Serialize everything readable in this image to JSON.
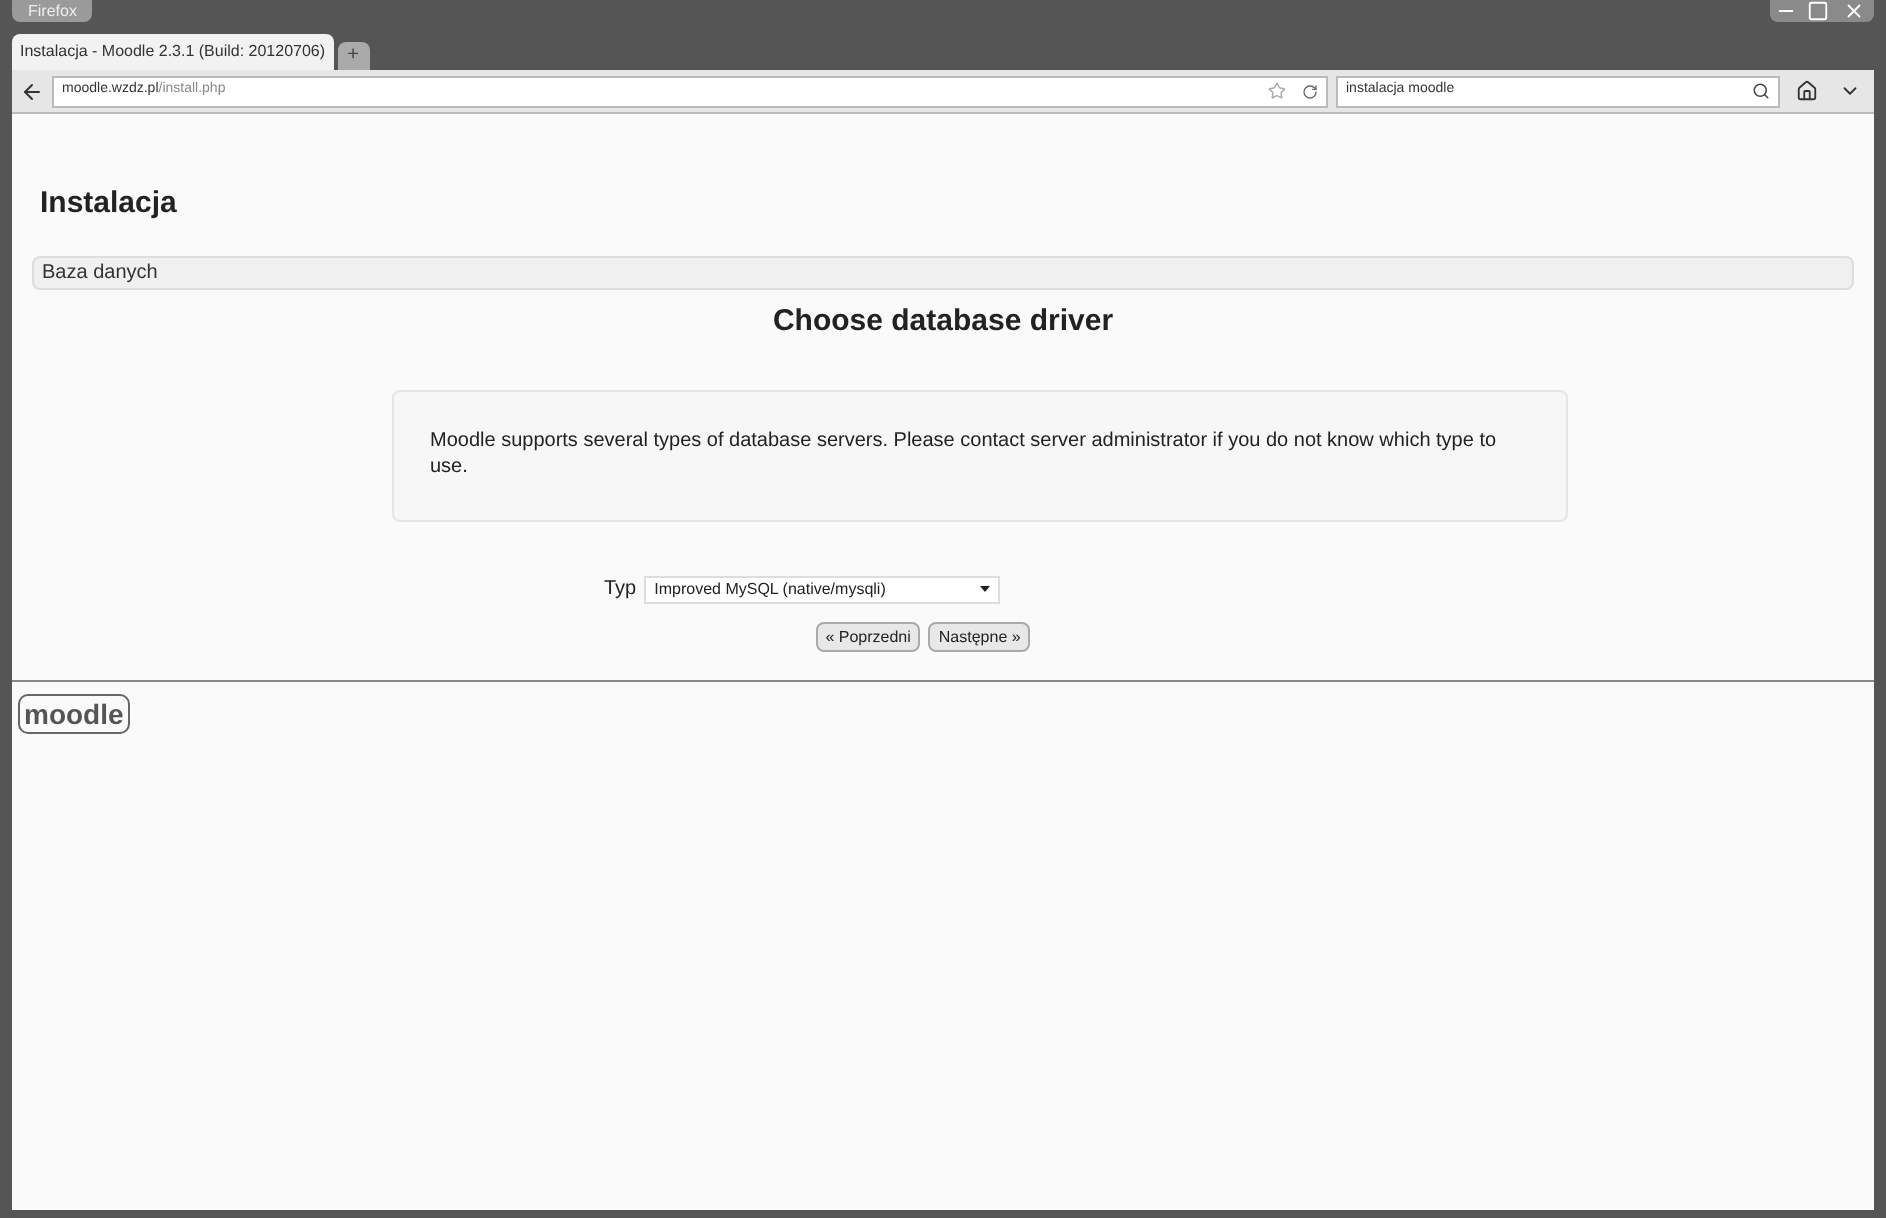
{
  "browser": {
    "menu_button": "Firefox",
    "tabs": [
      {
        "title": "Instalacja - Moodle 2.3.1 (Build: 20120706)",
        "selected": true
      }
    ],
    "new_tab": "+",
    "url_host": "moodle.wzdz.pl",
    "url_path": "/install.php",
    "search_value": "instalacja moodle"
  },
  "page": {
    "heading": "Instalacja",
    "breadcrumb": "Baza danych",
    "title": "Choose database driver",
    "notice": "Moodle supports several types of database servers. Please contact server administrator if you do not know which type to use.",
    "field_label": "Typ",
    "field_value": "Improved MySQL (native/mysqli)",
    "buttons": [
      "« Poprzedni",
      "Następne »"
    ],
    "footer_logo": "moodle"
  }
}
